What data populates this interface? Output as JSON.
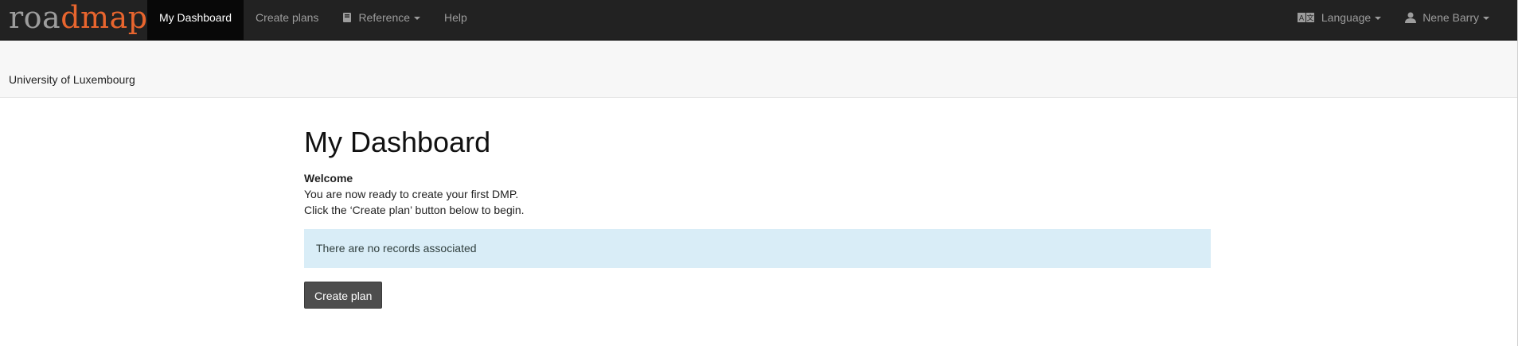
{
  "brand": {
    "part1": "roa",
    "part2": "dmap"
  },
  "nav": {
    "items": [
      {
        "label": "My Dashboard",
        "active": true
      },
      {
        "label": "Create plans"
      },
      {
        "label": "Reference",
        "icon": "book-icon",
        "dropdown": true
      },
      {
        "label": "Help"
      }
    ],
    "right": [
      {
        "label": "Language",
        "icon": "language-icon",
        "dropdown": true
      },
      {
        "label": "Nene Barry",
        "icon": "user-icon",
        "dropdown": true
      }
    ]
  },
  "org": {
    "name": "University of Luxembourg"
  },
  "main": {
    "title": "My Dashboard",
    "welcome_title": "Welcome",
    "welcome_line1": "You are now ready to create your first DMP.",
    "welcome_line2": "Click the ‘Create plan’ button below to begin.",
    "alert_text": "There are no records associated",
    "create_button": "Create plan"
  },
  "colors": {
    "navbar": "#222222",
    "accent": "#e8652e",
    "alert_bg": "#d9edf7",
    "button_bg": "#4d4d4d"
  }
}
